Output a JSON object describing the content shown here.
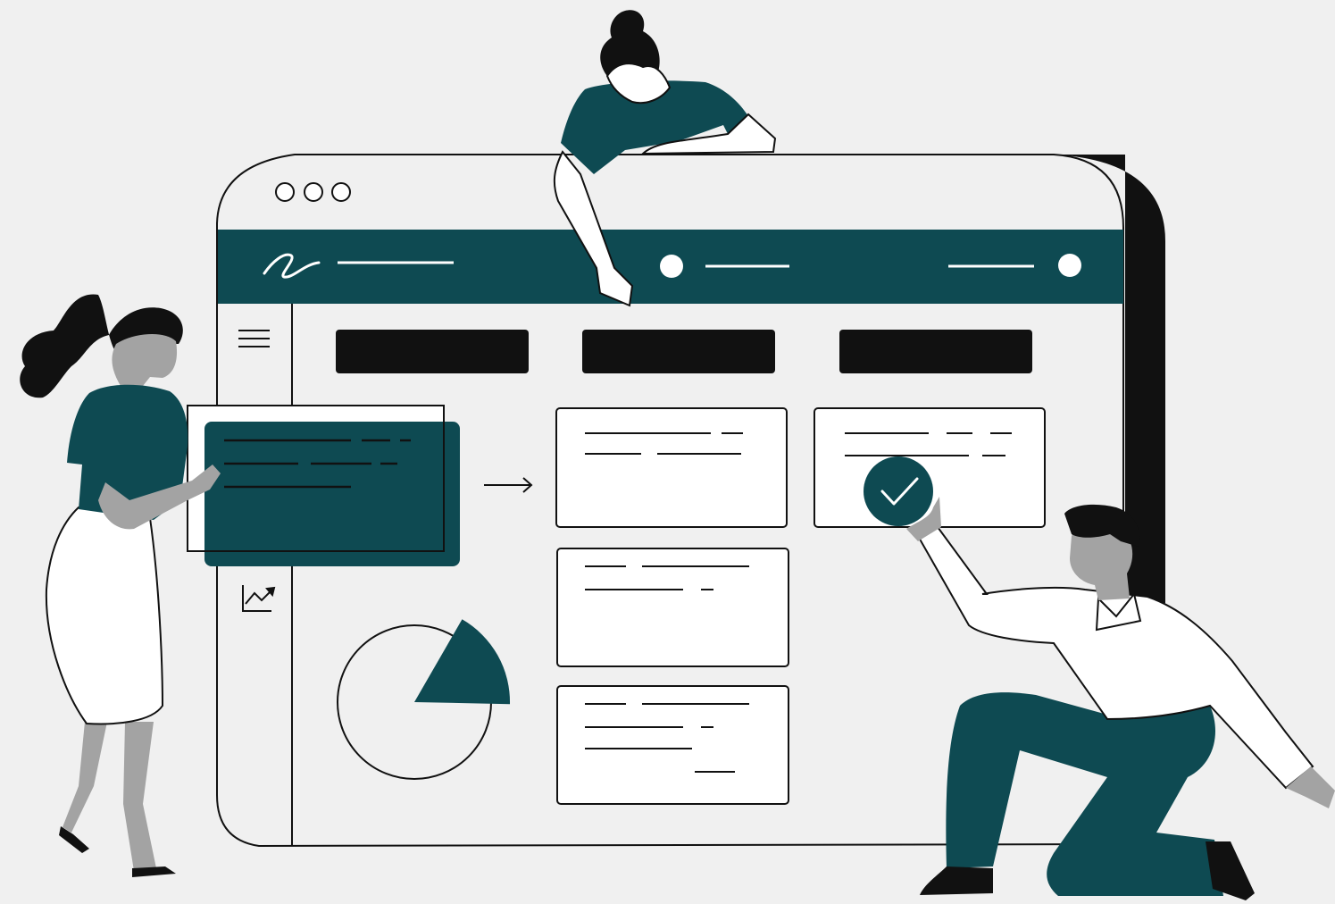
{
  "colors": {
    "background": "#f0f0f0",
    "brand_teal": "#0e4a52",
    "ink": "#111111",
    "paper": "#ffffff",
    "skin_gray": "#a3a3a3"
  },
  "window": {
    "controls": [
      "dot",
      "dot",
      "dot"
    ],
    "header_logo": "signature-logo",
    "sidebar_icons": [
      "menu-icon",
      "trend-chart-icon"
    ]
  },
  "board": {
    "columns": 3,
    "column_1_cards": 1,
    "column_2_cards": 3,
    "column_3_cards": 1,
    "card_status": "check-icon"
  },
  "pie": {
    "highlighted_fraction": 0.17
  },
  "figures": [
    "woman-with-ponytail",
    "woman-with-bun-leaning-over",
    "kneeling-man"
  ]
}
